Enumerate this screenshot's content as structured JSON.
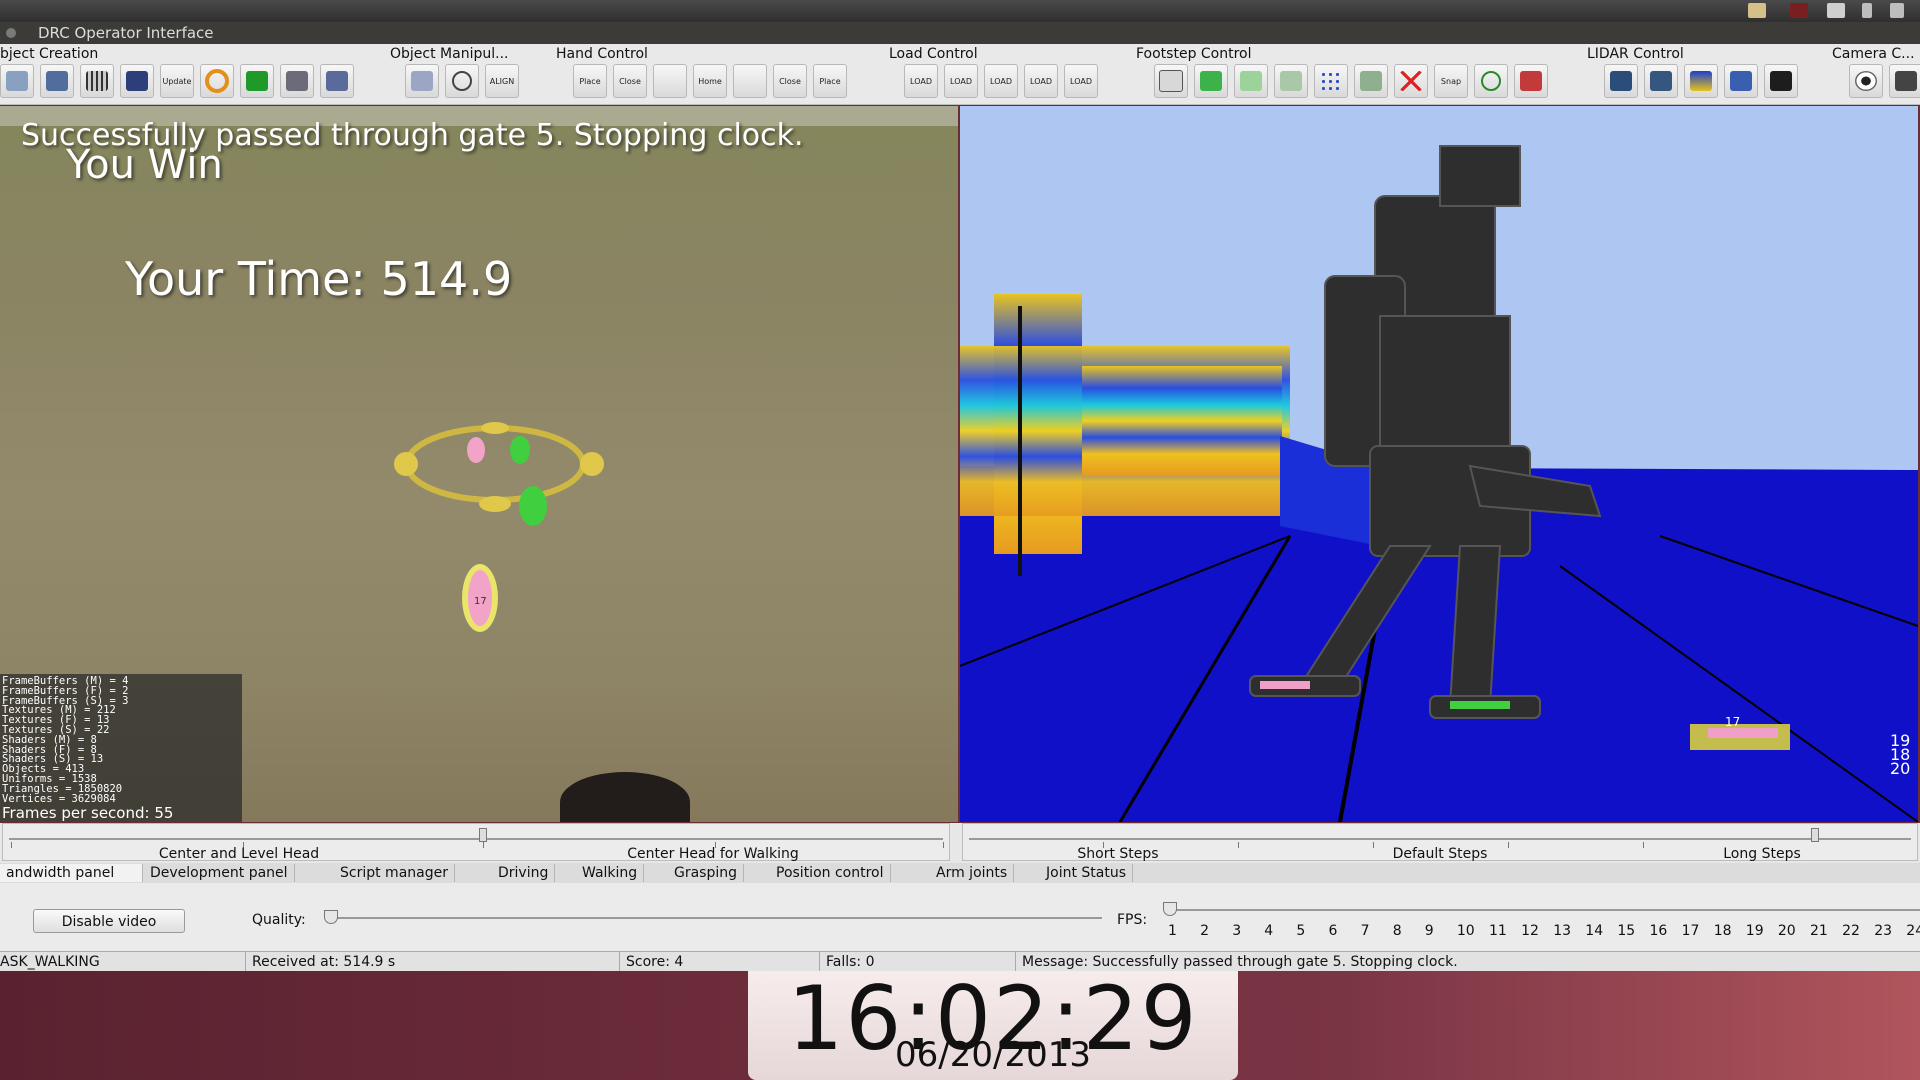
{
  "window": {
    "title": "DRC Operator Interface"
  },
  "toolbar_groups": [
    {
      "label": "Object Creation",
      "display": "bject Creation"
    },
    {
      "label": "Object Manipul...",
      "display": "Object Manipul..."
    },
    {
      "label": "Hand Control",
      "display": "Hand Control"
    },
    {
      "label": "Load Control",
      "display": "Load Control"
    },
    {
      "label": "Footstep Control",
      "display": "Footstep Control"
    },
    {
      "label": "LIDAR Control",
      "display": "LIDAR Control"
    },
    {
      "label": "Camera C...",
      "display": "Camera C..."
    }
  ],
  "toolbar_button_texts": {
    "align": "ALIGN",
    "place": "Place",
    "close": "Close",
    "home": "Home",
    "load": "LOAD",
    "update": "Update",
    "snap": "Snap"
  },
  "left_view": {
    "message": "Successfully passed through gate 5. Stopping clock.",
    "win": "You Win",
    "time_label": "Your Time: 514.9",
    "footstep_number": "17",
    "stats": [
      "FrameBuffers (M) = 4",
      "FrameBuffers (F) = 2",
      "FrameBuffers (S) = 3",
      "Textures (M) = 212",
      "Textures (F) = 13",
      "Textures (S) = 22",
      "Shaders (M) = 8",
      "Shaders (F) = 8",
      "Shaders (S) = 13",
      "Objects = 413",
      "Uniforms = 1538",
      "Triangles = 1850820",
      "Vertices = 3629084"
    ],
    "fps_text": "Frames per second: 55"
  },
  "right_view": {
    "edge_labels": [
      "19",
      "18",
      "20"
    ],
    "footstep_number": "17"
  },
  "head_buttons": {
    "center_level": "Center and Level Head",
    "center_walking": "Center Head for Walking"
  },
  "step_buttons": {
    "short": "Short Steps",
    "default": "Default Steps",
    "long": "Long Steps"
  },
  "tabs": [
    {
      "label": "andwidth panel",
      "active": true
    },
    {
      "label": "Development panel"
    },
    {
      "label": "Script manager"
    },
    {
      "label": "Driving"
    },
    {
      "label": "Walking"
    },
    {
      "label": "Grasping"
    },
    {
      "label": "Position control"
    },
    {
      "label": "Arm joints"
    },
    {
      "label": "Joint Status"
    }
  ],
  "panel": {
    "disable_video": "Disable video",
    "quality_label": "Quality:",
    "quality_value": 0.0,
    "fps_label": "FPS:",
    "fps_value": 1,
    "fps_ticks": [
      "1",
      "2",
      "3",
      "4",
      "5",
      "6",
      "7",
      "8",
      "9",
      "10",
      "11",
      "12",
      "13",
      "14",
      "15",
      "16",
      "17",
      "18",
      "19",
      "20",
      "21",
      "22",
      "23",
      "24"
    ]
  },
  "status": {
    "task": "ASK_WALKING",
    "received": "Received at:  514.9 s",
    "score": "Score:  4",
    "falls": "Falls:  0",
    "message": "Message:  Successfully passed through gate 5. Stopping clock."
  },
  "clock": {
    "time": "16:02:29",
    "date": "06/20/2013"
  },
  "colors": {
    "lidar_floor": "#1010c8",
    "sky": "#aec6f2",
    "footstep_left": "#f0a0c8",
    "footstep_right": "#44cc44"
  }
}
